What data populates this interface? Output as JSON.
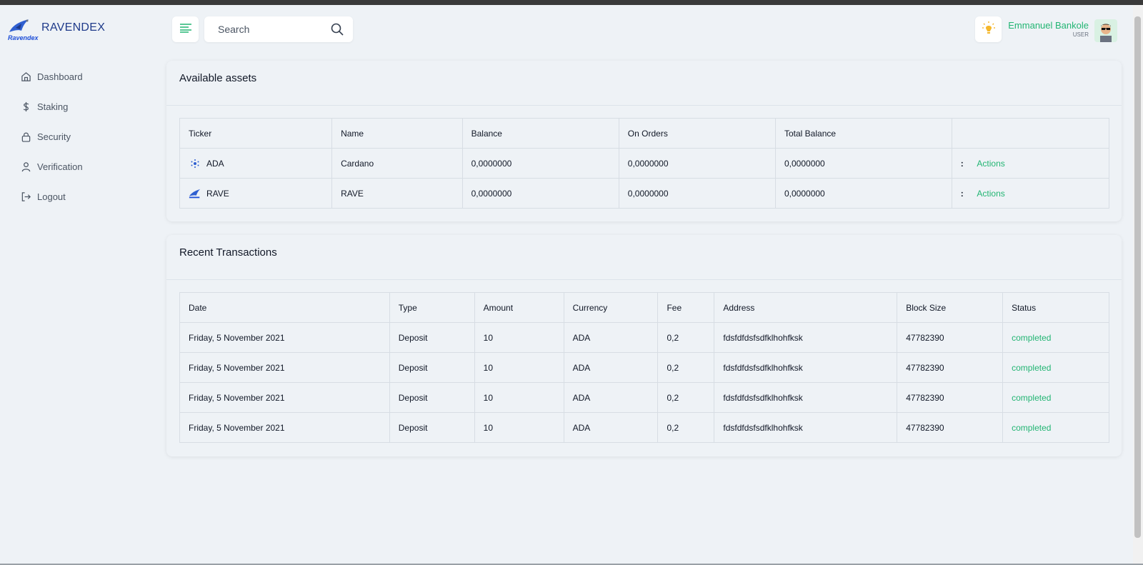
{
  "brand": {
    "title": "RAVENDEX",
    "logo_text": "Ravendex"
  },
  "sidebar": {
    "items": [
      {
        "label": "Dashboard",
        "icon": "home-icon"
      },
      {
        "label": "Staking",
        "icon": "dollar-icon"
      },
      {
        "label": "Security",
        "icon": "lock-icon"
      },
      {
        "label": "Verification",
        "icon": "user-icon"
      },
      {
        "label": "Logout",
        "icon": "logout-icon"
      }
    ]
  },
  "header": {
    "search": {
      "placeholder": "Search"
    },
    "user": {
      "name": "Emmanuel Bankole",
      "role": "USER"
    }
  },
  "assets": {
    "title": "Available assets",
    "columns": [
      "Ticker",
      "Name",
      "Balance",
      "On Orders",
      "Total Balance",
      ""
    ],
    "rows": [
      {
        "ticker": "ADA",
        "name": "Cardano",
        "balance": "0,0000000",
        "on_orders": "0,0000000",
        "total": "0,0000000",
        "dots": ":",
        "action": "Actions"
      },
      {
        "ticker": "RAVE",
        "name": "RAVE",
        "balance": "0,0000000",
        "on_orders": "0,0000000",
        "total": "0,0000000",
        "dots": ":",
        "action": "Actions"
      }
    ]
  },
  "transactions": {
    "title": "Recent Transactions",
    "columns": [
      "Date",
      "Type",
      "Amount",
      "Currency",
      "Fee",
      "Address",
      "Block Size",
      "Status"
    ],
    "rows": [
      {
        "date": "Friday, 5 November 2021",
        "type": "Deposit",
        "amount": "10",
        "currency": "ADA",
        "fee": "0,2",
        "address": "fdsfdfdsfsdfklhohfksk",
        "block": "47782390",
        "status": "completed"
      },
      {
        "date": "Friday, 5 November 2021",
        "type": "Deposit",
        "amount": "10",
        "currency": "ADA",
        "fee": "0,2",
        "address": "fdsfdfdsfsdfklhohfksk",
        "block": "47782390",
        "status": "completed"
      },
      {
        "date": "Friday, 5 November 2021",
        "type": "Deposit",
        "amount": "10",
        "currency": "ADA",
        "fee": "0,2",
        "address": "fdsfdfdsfsdfklhohfksk",
        "block": "47782390",
        "status": "completed"
      },
      {
        "date": "Friday, 5 November 2021",
        "type": "Deposit",
        "amount": "10",
        "currency": "ADA",
        "fee": "0,2",
        "address": "fdsfdfdsfsdfklhohfksk",
        "block": "47782390",
        "status": "completed"
      }
    ]
  },
  "colors": {
    "accent": "#22b573",
    "brand": "#1e3a8a",
    "background": "#eef2f6"
  }
}
